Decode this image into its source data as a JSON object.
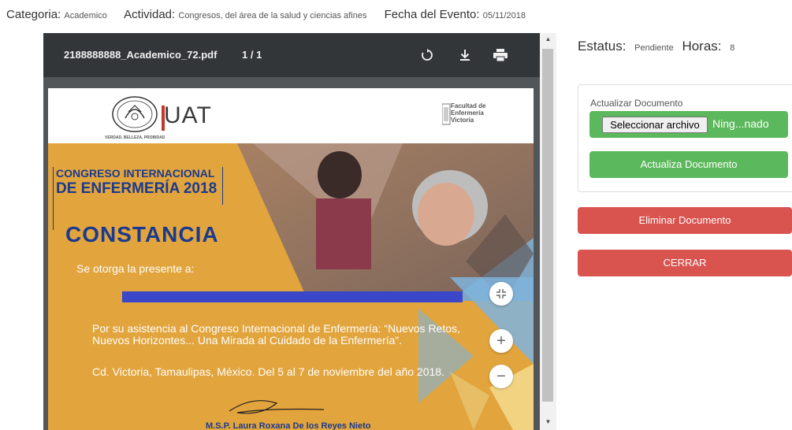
{
  "meta": {
    "categoria_label": "Categoria:",
    "categoria_value": "Academico",
    "actividad_label": "Actividad:",
    "actividad_value": "Congresos, del área de la salud y ciencias afines",
    "fecha_label": "Fecha del Evento:",
    "fecha_value": "05/11/2018"
  },
  "viewer": {
    "filename": "2188888888_Academico_72.pdf",
    "page_indicator": "1 / 1",
    "icons": {
      "rotate": "rotate-icon",
      "download": "download-icon",
      "print": "print-icon"
    }
  },
  "document": {
    "institution": "UAT",
    "seal_motto": "VERDAD, BELLEZA, PROBIDAD",
    "faculty": [
      "Facultad de",
      "Enfermería",
      "Victoria"
    ],
    "congreso_line1": "CONGRESO INTERNACIONAL",
    "congreso_line2": "DE ENFERMERÍA 2018",
    "title": "CONSTANCIA",
    "otorga": "Se otorga la presente a:",
    "paragraph": "Por su asistencia al Congreso Internacional de Enfermería: “Nuevos Retos, Nuevos Horizontes... Una Mirada al Cuidado de la Enfermería”.",
    "city_date": "Cd. Victoria, Tamaulipas, México. Del 5 al 7 de noviembre del año 2018.",
    "signer": "M.S.P. Laura Roxana De los Reyes Nieto"
  },
  "zoom_controls": {
    "fit": "fit-page-icon",
    "zoom_in": "+",
    "zoom_out": "−"
  },
  "status": {
    "estatus_label": "Estatus:",
    "estatus_value": "Pendiente",
    "horas_label": "Horas:",
    "horas_value": "8"
  },
  "update_panel": {
    "title": "Actualizar Documento",
    "file_button": "Seleccionar archivo",
    "file_name": "Ning...nado",
    "update_button": "Actualiza Documento"
  },
  "actions": {
    "delete_button": "Eliminar Documento",
    "close_button": "CERRAR"
  },
  "colors": {
    "green": "#5cb85c",
    "red": "#d9534f",
    "toolbar": "#323639",
    "doc_orange": "#e2a43c",
    "doc_blue": "#1a3a8f"
  }
}
